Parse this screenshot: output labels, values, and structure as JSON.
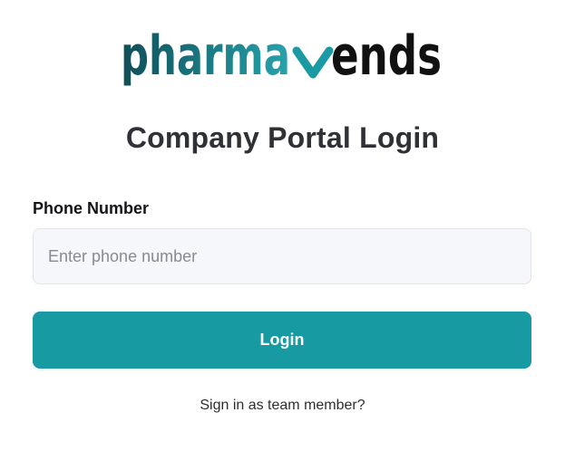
{
  "logo": {
    "text": "pharmavends",
    "text_part1": "pharma",
    "text_part2": "ends",
    "colors": {
      "gradient_start": "#0f4e57",
      "gradient_end": "#27a3ac",
      "dark": "#111111",
      "accent_v": "#1b9aa3"
    }
  },
  "page_title": "Company Portal Login",
  "phone": {
    "label": "Phone Number",
    "placeholder": "Enter phone number",
    "value": ""
  },
  "login_button": {
    "label": "Login",
    "color": "#189aa3"
  },
  "team_link": {
    "label": "Sign in as team member?"
  }
}
